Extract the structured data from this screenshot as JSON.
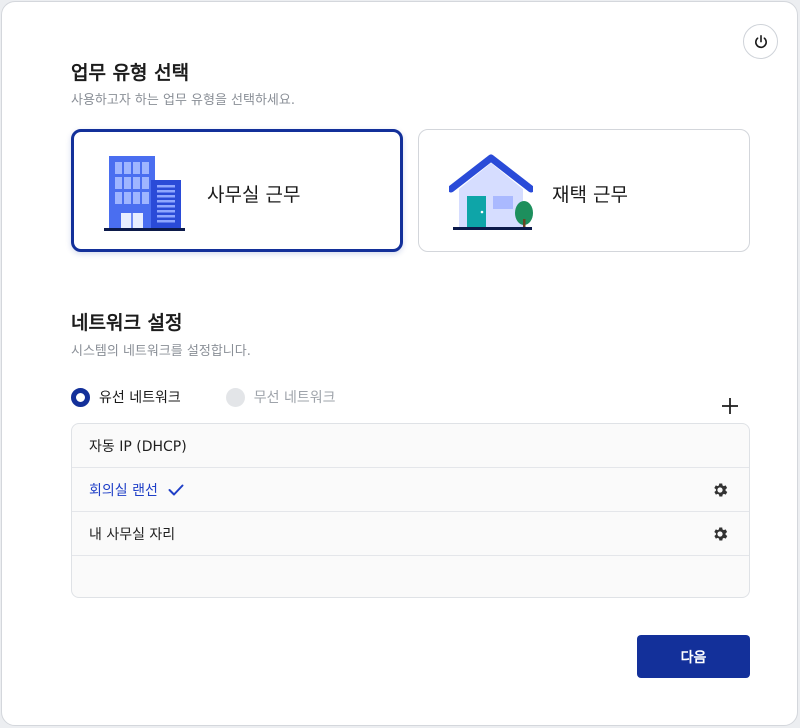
{
  "work_type": {
    "title": "업무 유형 선택",
    "subtitle": "사용하고자 하는 업무 유형을 선택하세요.",
    "options": [
      {
        "label": "사무실 근무",
        "icon": "office-building-icon",
        "selected": true
      },
      {
        "label": "재택 근무",
        "icon": "house-icon",
        "selected": false
      }
    ]
  },
  "network": {
    "title": "네트워크 설정",
    "subtitle": "시스템의 네트워크를 설정합니다.",
    "modes": [
      {
        "label": "유선 네트워크",
        "selected": true,
        "enabled": true
      },
      {
        "label": "무선 네트워크",
        "selected": false,
        "enabled": false
      }
    ],
    "add_icon": "plus-icon",
    "items": [
      {
        "name": "자동 IP (DHCP)",
        "active": false,
        "configurable": false
      },
      {
        "name": "회의실 랜선",
        "active": true,
        "configurable": true
      },
      {
        "name": "내 사무실 자리",
        "active": false,
        "configurable": true
      }
    ]
  },
  "actions": {
    "next_label": "다음"
  },
  "colors": {
    "accent": "#13309a",
    "active_text": "#1f3fc7",
    "disabled": "#e3e5e8"
  }
}
